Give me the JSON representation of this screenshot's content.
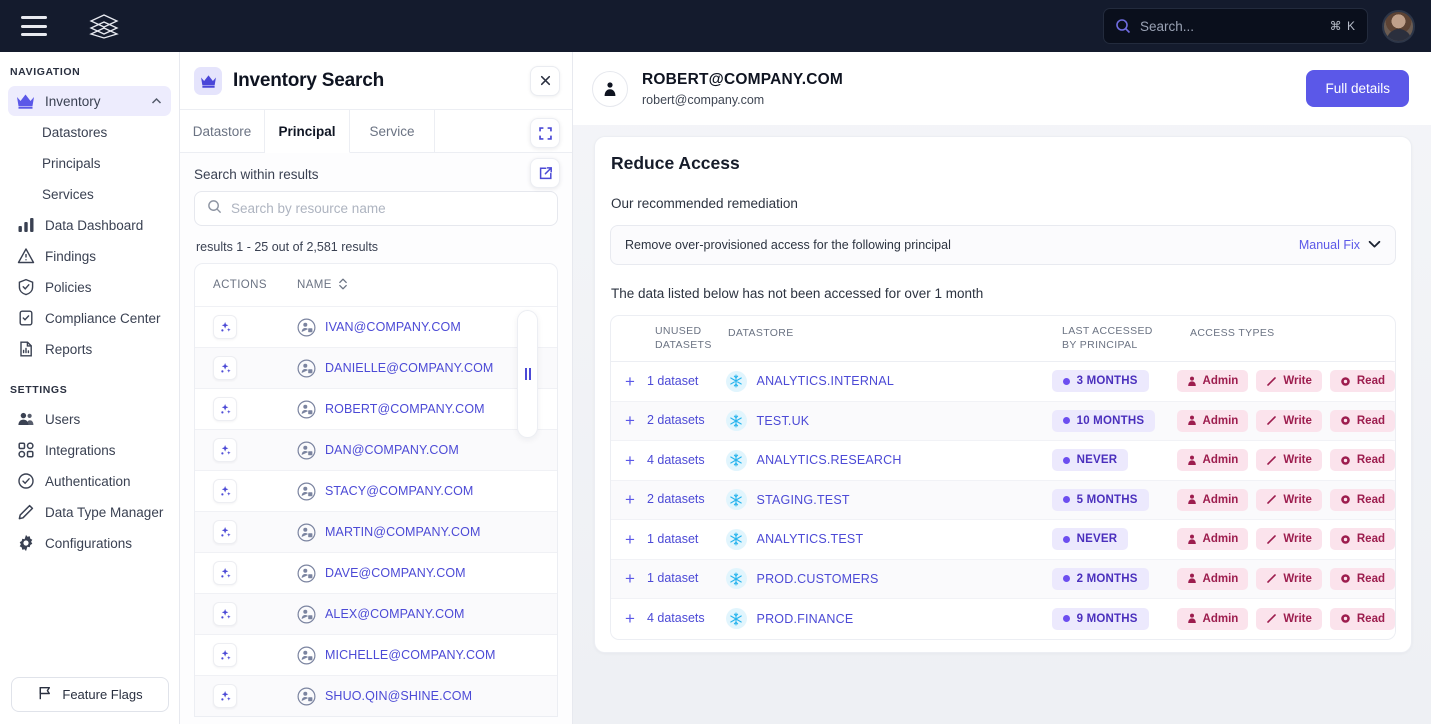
{
  "topbar": {
    "menu_icon": "hamburger-icon",
    "logo_icon": "layers-logo-icon",
    "search_placeholder": "Search...",
    "search_value": "",
    "shortcut": "⌘ K",
    "avatar": "user-avatar"
  },
  "sidebar": {
    "navigation_label": "NAVIGATION",
    "settings_label": "SETTINGS",
    "nav_items": [
      {
        "label": "Inventory",
        "icon": "crown-icon",
        "active": true,
        "expanded": true
      },
      {
        "label": "Data Dashboard",
        "icon": "bar-chart-icon",
        "active": false
      },
      {
        "label": "Findings",
        "icon": "warning-triangle-icon",
        "active": false
      },
      {
        "label": "Policies",
        "icon": "shield-check-icon",
        "active": false
      },
      {
        "label": "Compliance Center",
        "icon": "clipboard-check-icon",
        "active": false
      },
      {
        "label": "Reports",
        "icon": "document-chart-icon",
        "active": false
      }
    ],
    "nav_subitems": [
      {
        "label": "Datastores"
      },
      {
        "label": "Principals"
      },
      {
        "label": "Services"
      }
    ],
    "settings_items": [
      {
        "label": "Users",
        "icon": "users-icon"
      },
      {
        "label": "Integrations",
        "icon": "grid-puzzle-icon"
      },
      {
        "label": "Authentication",
        "icon": "check-badge-icon"
      },
      {
        "label": "Data Type Manager",
        "icon": "pencil-icon"
      },
      {
        "label": "Configurations",
        "icon": "gear-icon"
      }
    ],
    "feature_flags_label": "Feature Flags",
    "feature_flags_icon": "flag-icon"
  },
  "results_panel": {
    "title": "Inventory Search",
    "title_icon": "crown-icon",
    "close_icon": "close-icon",
    "tabs": [
      {
        "label": "Datastore",
        "active": false
      },
      {
        "label": "Principal",
        "active": true
      },
      {
        "label": "Service",
        "active": false
      }
    ],
    "search_within_label": "Search within results",
    "search_placeholder": "Search by resource name",
    "search_value": "",
    "results_count": "results 1 - 25 out of 2,581 results",
    "columns": {
      "actions": "ACTIONS",
      "name": "NAME"
    },
    "sort_icon": "sort-updown-icon",
    "expand_icon": "expand-corners-icon",
    "external_link_icon": "external-link-icon",
    "resizer_icon": "drag-handle-icon",
    "rows": [
      {
        "name": "IVAN@COMPANY.COM"
      },
      {
        "name": "DANIELLE@COMPANY.COM"
      },
      {
        "name": "ROBERT@COMPANY.COM"
      },
      {
        "name": "DAN@COMPANY.COM"
      },
      {
        "name": "STACY@COMPANY.COM"
      },
      {
        "name": "MARTIN@COMPANY.COM"
      },
      {
        "name": "DAVE@COMPANY.COM"
      },
      {
        "name": "ALEX@COMPANY.COM"
      },
      {
        "name": "MICHELLE@COMPANY.COM"
      },
      {
        "name": "SHUO.QIN@SHINE.COM"
      }
    ]
  },
  "detail": {
    "principal_name": "ROBERT@COMPANY.COM",
    "principal_email": "robert@company.com",
    "avatar_icon": "person-icon",
    "full_details_label": "Full details",
    "card_title": "Reduce Access",
    "card_subtitle": "Our recommended remediation",
    "remediation_text": "Remove over-provisioned access for the following principal",
    "manual_fix_label": "Manual Fix",
    "manual_fix_icon": "chevron-down-icon",
    "note": "The data listed below has not been accessed for over 1 month",
    "table": {
      "headers": {
        "unused": "UNUSED DATASETS",
        "unused_l1": "UNUSED",
        "unused_l2": "DATASETS",
        "datastore": "DATASTORE",
        "last_accessed_l1": "LAST ACCESSED",
        "last_accessed_l2": "BY PRINCIPAL",
        "access_types": "ACCESS TYPES"
      },
      "expand_icon": "plus-icon",
      "datastore_icon": "snowflake-icon",
      "rows": [
        {
          "unused": "1 dataset",
          "datastore": "ANALYTICS.INTERNAL",
          "last_accessed": "3 MONTHS",
          "access": [
            "Admin",
            "Write",
            "Read"
          ]
        },
        {
          "unused": "2 datasets",
          "datastore": "TEST.UK",
          "last_accessed": "10 MONTHS",
          "access": [
            "Admin",
            "Write",
            "Read"
          ]
        },
        {
          "unused": "4 datasets",
          "datastore": "ANALYTICS.RESEARCH",
          "last_accessed": "NEVER",
          "access": [
            "Admin",
            "Write",
            "Read"
          ]
        },
        {
          "unused": "2 datasets",
          "datastore": "STAGING.TEST",
          "last_accessed": "5 MONTHS",
          "access": [
            "Admin",
            "Write",
            "Read"
          ]
        },
        {
          "unused": "1 dataset",
          "datastore": "ANALYTICS.TEST",
          "last_accessed": "NEVER",
          "access": [
            "Admin",
            "Write",
            "Read"
          ]
        },
        {
          "unused": "1 dataset",
          "datastore": "PROD.CUSTOMERS",
          "last_accessed": "2 MONTHS",
          "access": [
            "Admin",
            "Write",
            "Read"
          ]
        },
        {
          "unused": "4 datasets",
          "datastore": "PROD.FINANCE",
          "last_accessed": "9 MONTHS",
          "access": [
            "Admin",
            "Write",
            "Read"
          ]
        }
      ],
      "access_icons": {
        "Admin": "person-filled-icon",
        "Write": "pencil-icon",
        "Read": "eye-icon"
      }
    }
  },
  "colors": {
    "topbar_bg": "#141b2d",
    "accent_purple": "#5b58e8",
    "link_purple": "#4c4ad6",
    "pill_time_bg": "#ece9fd",
    "pill_time_text": "#4a2fbd",
    "pill_access_bg": "#fbe3ec",
    "pill_access_text": "#9d1d4e",
    "snowflake_bg": "#e1f5fd"
  }
}
